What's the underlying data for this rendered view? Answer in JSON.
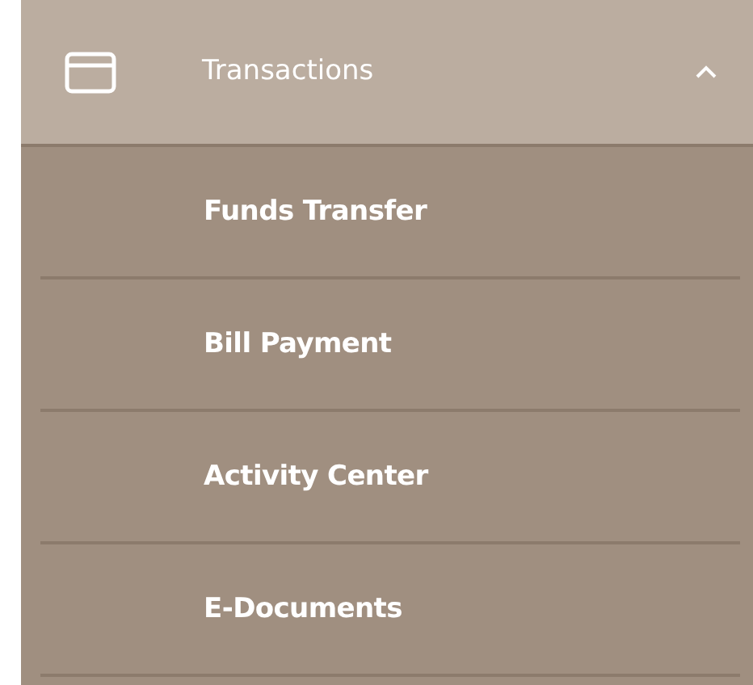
{
  "menu": {
    "label": "Transactions",
    "expanded": true,
    "items": [
      {
        "label": "Funds Transfer"
      },
      {
        "label": "Bill Payment"
      },
      {
        "label": "Activity Center"
      },
      {
        "label": "E-Documents"
      }
    ]
  }
}
